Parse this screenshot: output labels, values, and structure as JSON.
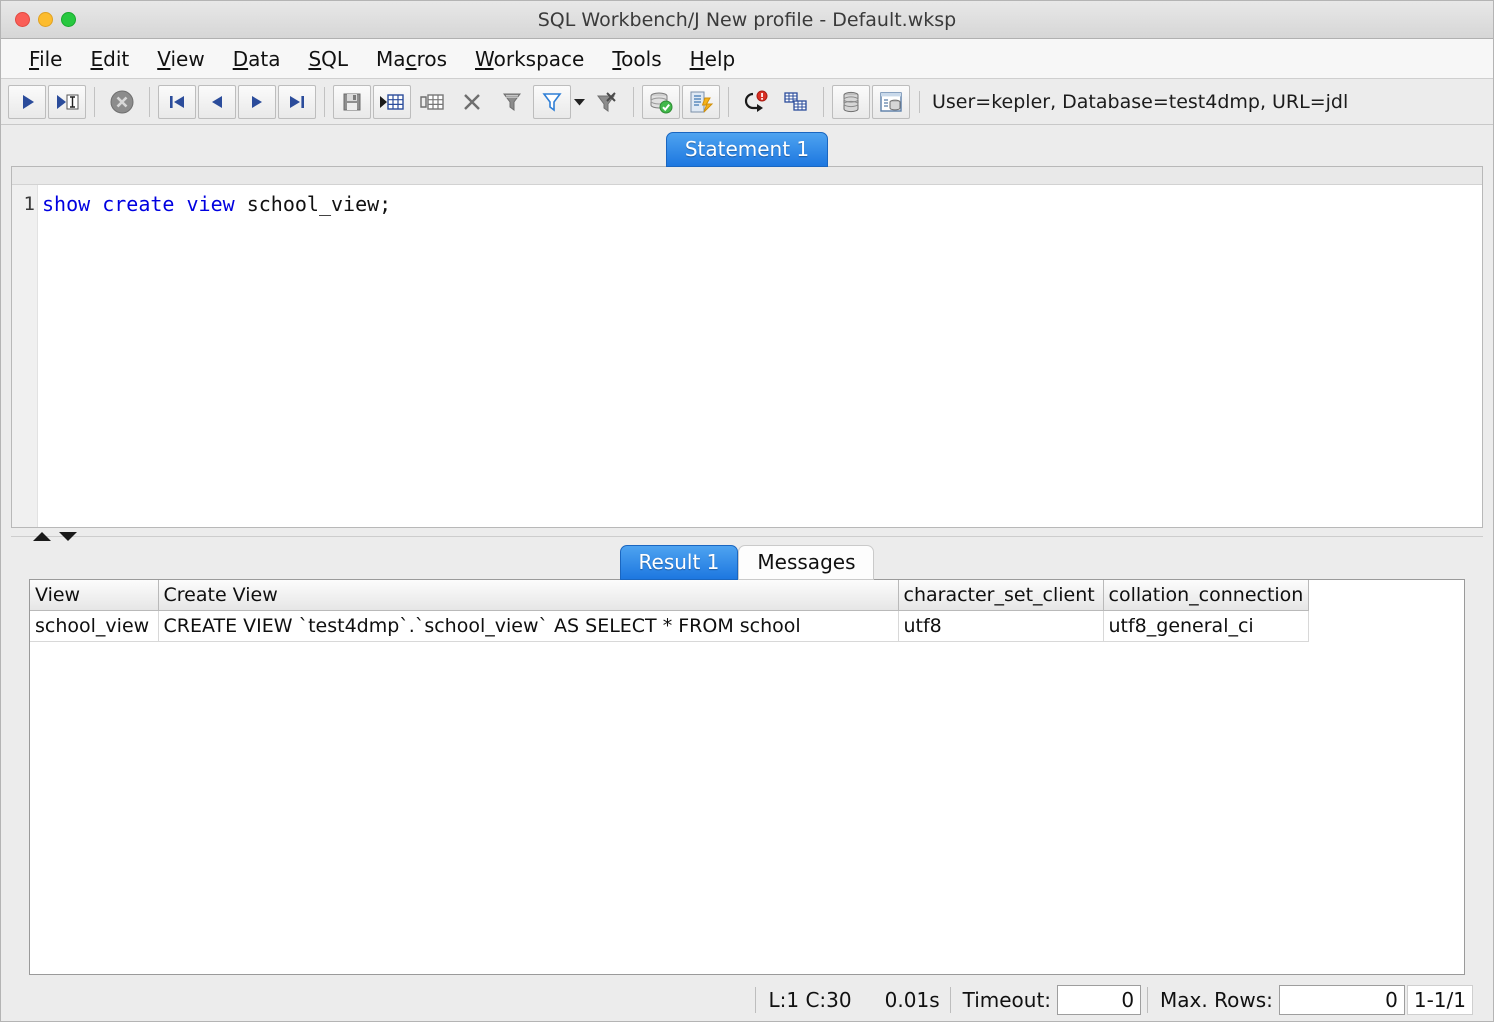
{
  "window": {
    "title": "SQL Workbench/J New profile - Default.wksp",
    "traffic": [
      "close",
      "minimize",
      "zoom"
    ]
  },
  "menubar": {
    "items": [
      {
        "label": "File",
        "mnemonic_index": 0
      },
      {
        "label": "Edit",
        "mnemonic_index": 0
      },
      {
        "label": "View",
        "mnemonic_index": 0
      },
      {
        "label": "Data",
        "mnemonic_index": 0
      },
      {
        "label": "SQL",
        "mnemonic_index": 0
      },
      {
        "label": "Macros",
        "mnemonic_index": 2
      },
      {
        "label": "Workspace",
        "mnemonic_index": 0
      },
      {
        "label": "Tools",
        "mnemonic_index": 0
      },
      {
        "label": "Help",
        "mnemonic_index": 0
      }
    ]
  },
  "toolbar": {
    "buttons": [
      {
        "name": "execute-all-icon",
        "tooltip": "Execute all statements"
      },
      {
        "name": "execute-current-icon",
        "tooltip": "Execute current statement"
      },
      {
        "name": "stop-icon",
        "tooltip": "Cancel"
      },
      {
        "name": "first-row-icon",
        "tooltip": "First row"
      },
      {
        "name": "previous-row-icon",
        "tooltip": "Previous row"
      },
      {
        "name": "next-row-icon",
        "tooltip": "Next row"
      },
      {
        "name": "last-row-icon",
        "tooltip": "Last row"
      },
      {
        "name": "save-data-icon",
        "tooltip": "Save data changes"
      },
      {
        "name": "insert-row-icon",
        "tooltip": "Insert row"
      },
      {
        "name": "copy-row-icon",
        "tooltip": "Duplicate row"
      },
      {
        "name": "delete-row-icon",
        "tooltip": "Delete row"
      },
      {
        "name": "define-filter-icon",
        "tooltip": "Define filter"
      },
      {
        "name": "apply-filter-icon",
        "tooltip": "Apply filter"
      },
      {
        "name": "filter-dropdown-caret-icon",
        "tooltip": "Filter options"
      },
      {
        "name": "clear-filter-icon",
        "tooltip": "Reset filter"
      },
      {
        "name": "connect-icon",
        "tooltip": "Connect"
      },
      {
        "name": "execute-script-icon",
        "tooltip": "Execute script"
      },
      {
        "name": "rollback-icon",
        "tooltip": "Rollback"
      },
      {
        "name": "show-objects-icon",
        "tooltip": "Show object list"
      },
      {
        "name": "database-explorer-icon",
        "tooltip": "Database Explorer"
      },
      {
        "name": "object-details-icon",
        "tooltip": "Object details"
      }
    ],
    "connection_info": "User=kepler, Database=test4dmp, URL=jdl"
  },
  "editor": {
    "tabs": [
      {
        "label": "Statement 1",
        "active": true
      }
    ],
    "line_numbers": [
      "1"
    ],
    "statement": {
      "keywords": "show create view",
      "rest": " school_view;",
      "full_text": "show create view school_view;"
    }
  },
  "results": {
    "tabs": [
      {
        "label": "Result 1",
        "active": true
      },
      {
        "label": "Messages",
        "active": false
      }
    ],
    "columns": [
      "View",
      "Create View",
      "character_set_client",
      "collation_connection"
    ],
    "rows": [
      [
        "school_view",
        "CREATE VIEW `test4dmp`.`school_view` AS SELECT * FROM   school",
        "utf8",
        "utf8_general_ci"
      ]
    ]
  },
  "statusbar": {
    "cursor_position": "L:1 C:30",
    "execution_time": "0.01s",
    "timeout_label": "Timeout:",
    "timeout_value": "0",
    "max_rows_label": "Max. Rows:",
    "max_rows_value": "0",
    "row_range": "1-1/1"
  },
  "colors": {
    "accent_tab": "#1d77e0",
    "keyword": "#0000e0",
    "window_bg": "#ececec",
    "grid_bg": "#ffffff"
  }
}
